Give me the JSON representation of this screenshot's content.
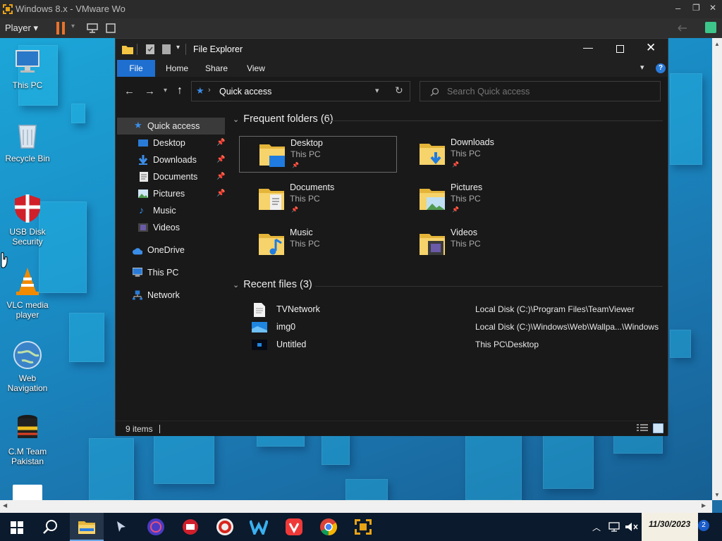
{
  "vm": {
    "title": "Windows 8.x - VMware Wo",
    "player_label": "Player",
    "win_controls": [
      "–",
      "❐",
      "✕"
    ]
  },
  "desktop_icons": [
    {
      "label": "This PC",
      "icon": "computer-icon"
    },
    {
      "label": "Recycle Bin",
      "icon": "recycle-bin-icon"
    },
    {
      "label": "USB Disk Security",
      "icon": "shield-icon"
    },
    {
      "label": "VLC media player",
      "icon": "vlc-cone-icon"
    },
    {
      "label": "Web Navigation",
      "icon": "globe-icon"
    },
    {
      "label": "C.M Team Pakistan",
      "icon": "cm-team-icon"
    }
  ],
  "explorer": {
    "title": "File Explorer",
    "ribbon_tabs": [
      "File",
      "Home",
      "Share",
      "View"
    ],
    "address": "Quick access",
    "search_placeholder": "Search Quick access",
    "nav": [
      {
        "label": "Quick access",
        "icon": "star-icon",
        "pinned": false
      },
      {
        "label": "Desktop",
        "icon": "desktop-folder-icon",
        "pinned": true
      },
      {
        "label": "Downloads",
        "icon": "download-arrow-icon",
        "pinned": true
      },
      {
        "label": "Documents",
        "icon": "document-icon",
        "pinned": true
      },
      {
        "label": "Pictures",
        "icon": "picture-icon",
        "pinned": true
      },
      {
        "label": "Music",
        "icon": "music-icon",
        "pinned": false
      },
      {
        "label": "Videos",
        "icon": "video-icon",
        "pinned": false
      },
      {
        "label": "OneDrive",
        "icon": "cloud-icon",
        "pinned": false
      },
      {
        "label": "This PC",
        "icon": "computer-icon",
        "pinned": false
      },
      {
        "label": "Network",
        "icon": "network-icon",
        "pinned": false
      }
    ],
    "frequent_header": "Frequent folders (6)",
    "frequent": [
      {
        "name": "Desktop",
        "location": "This PC",
        "pinned": true,
        "icon": "desktop-folder-icon"
      },
      {
        "name": "Downloads",
        "location": "This PC",
        "pinned": true,
        "icon": "downloads-folder-icon"
      },
      {
        "name": "Documents",
        "location": "This PC",
        "pinned": true,
        "icon": "documents-folder-icon"
      },
      {
        "name": "Pictures",
        "location": "This PC",
        "pinned": true,
        "icon": "pictures-folder-icon"
      },
      {
        "name": "Music",
        "location": "This PC",
        "pinned": false,
        "icon": "music-folder-icon"
      },
      {
        "name": "Videos",
        "location": "This PC",
        "pinned": false,
        "icon": "videos-folder-icon"
      }
    ],
    "recent_header": "Recent files (3)",
    "recent": [
      {
        "name": "TVNetwork",
        "path": "Local Disk (C:)\\Program Files\\TeamViewer",
        "icon": "text-file-icon"
      },
      {
        "name": "img0",
        "path": "Local Disk (C:)\\Windows\\Web\\Wallpa...\\Windows",
        "icon": "image-file-icon"
      },
      {
        "name": "Untitled",
        "path": "This PC\\Desktop",
        "icon": "dark-image-file-icon"
      }
    ],
    "status": "9 items"
  },
  "taskbar": {
    "apps": [
      "file-explorer-icon",
      "cursor-app-icon",
      "globe-app-icon",
      "camera-app-icon",
      "ccleaner-icon",
      "w-app-icon",
      "vivaldi-icon",
      "chrome-icon",
      "vmware-icon"
    ],
    "date": "11/30/2023",
    "notification_count": "2"
  }
}
